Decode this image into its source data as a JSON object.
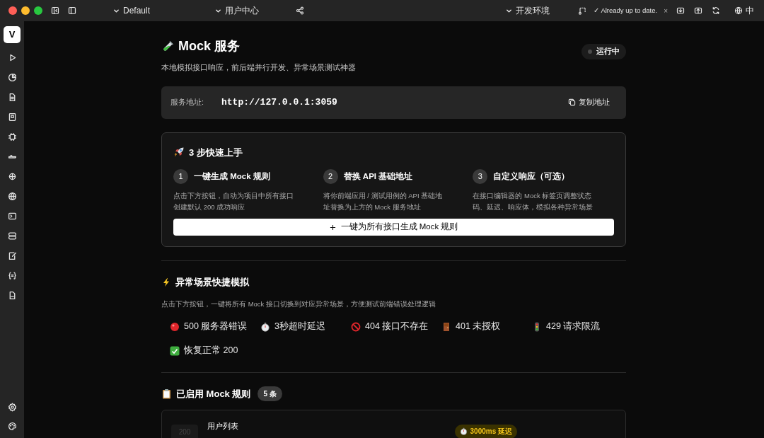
{
  "toolbar": {
    "project": "Default",
    "module": "用户中心",
    "environment": "开发环境",
    "update_status": "✓ Already up to date.",
    "dismiss": "×",
    "language": "中"
  },
  "sidebar": {
    "logo": "V"
  },
  "header": {
    "title": "Mock 服务",
    "subtitle": "本地模拟接口响应，前后端并行开发、异常场景测试神器",
    "status": "运行中"
  },
  "address": {
    "label": "服务地址:",
    "url": "http://127.0.0.1:3059",
    "copy_button": "复制地址"
  },
  "quick_start": {
    "title": "3 步快速上手",
    "steps": [
      {
        "number": "1",
        "title": "一键生成 Mock 规则",
        "description": "点击下方按钮，自动为项目中所有接口创建默认 200 成功响应"
      },
      {
        "number": "2",
        "title": "替换 API 基础地址",
        "description": "将你前端应用 / 测试用例的 API 基础地址替换为上方的 Mock 服务地址"
      },
      {
        "number": "3",
        "title": "自定义响应（可选）",
        "description": "在接口编辑器的 Mock 标签页调整状态码、延迟、响应体，模拟各种异常场景"
      }
    ],
    "button": "一键为所有接口生成 Mock 规则"
  },
  "scenarios": {
    "title": "异常场景快捷模拟",
    "description": "点击下方按钮，一键将所有 Mock 接口切换到对应异常场景，方便测试前端错误处理逻辑",
    "buttons": [
      {
        "kind": "error",
        "label": "500 服务器错误"
      },
      {
        "kind": "timeout",
        "label": "3秒超时延迟"
      },
      {
        "kind": "notfound",
        "label": "404 接口不存在"
      },
      {
        "kind": "unauthorized",
        "label": "401 未授权"
      },
      {
        "kind": "ratelimit",
        "label": "429 请求限流"
      },
      {
        "kind": "restore",
        "label": "恢复正常 200"
      }
    ]
  },
  "rules": {
    "title": "已启用 Mock 规则",
    "count": "5 条",
    "items": [
      {
        "status": "200",
        "name": "用户列表",
        "delay": "3000ms 延迟"
      }
    ]
  }
}
